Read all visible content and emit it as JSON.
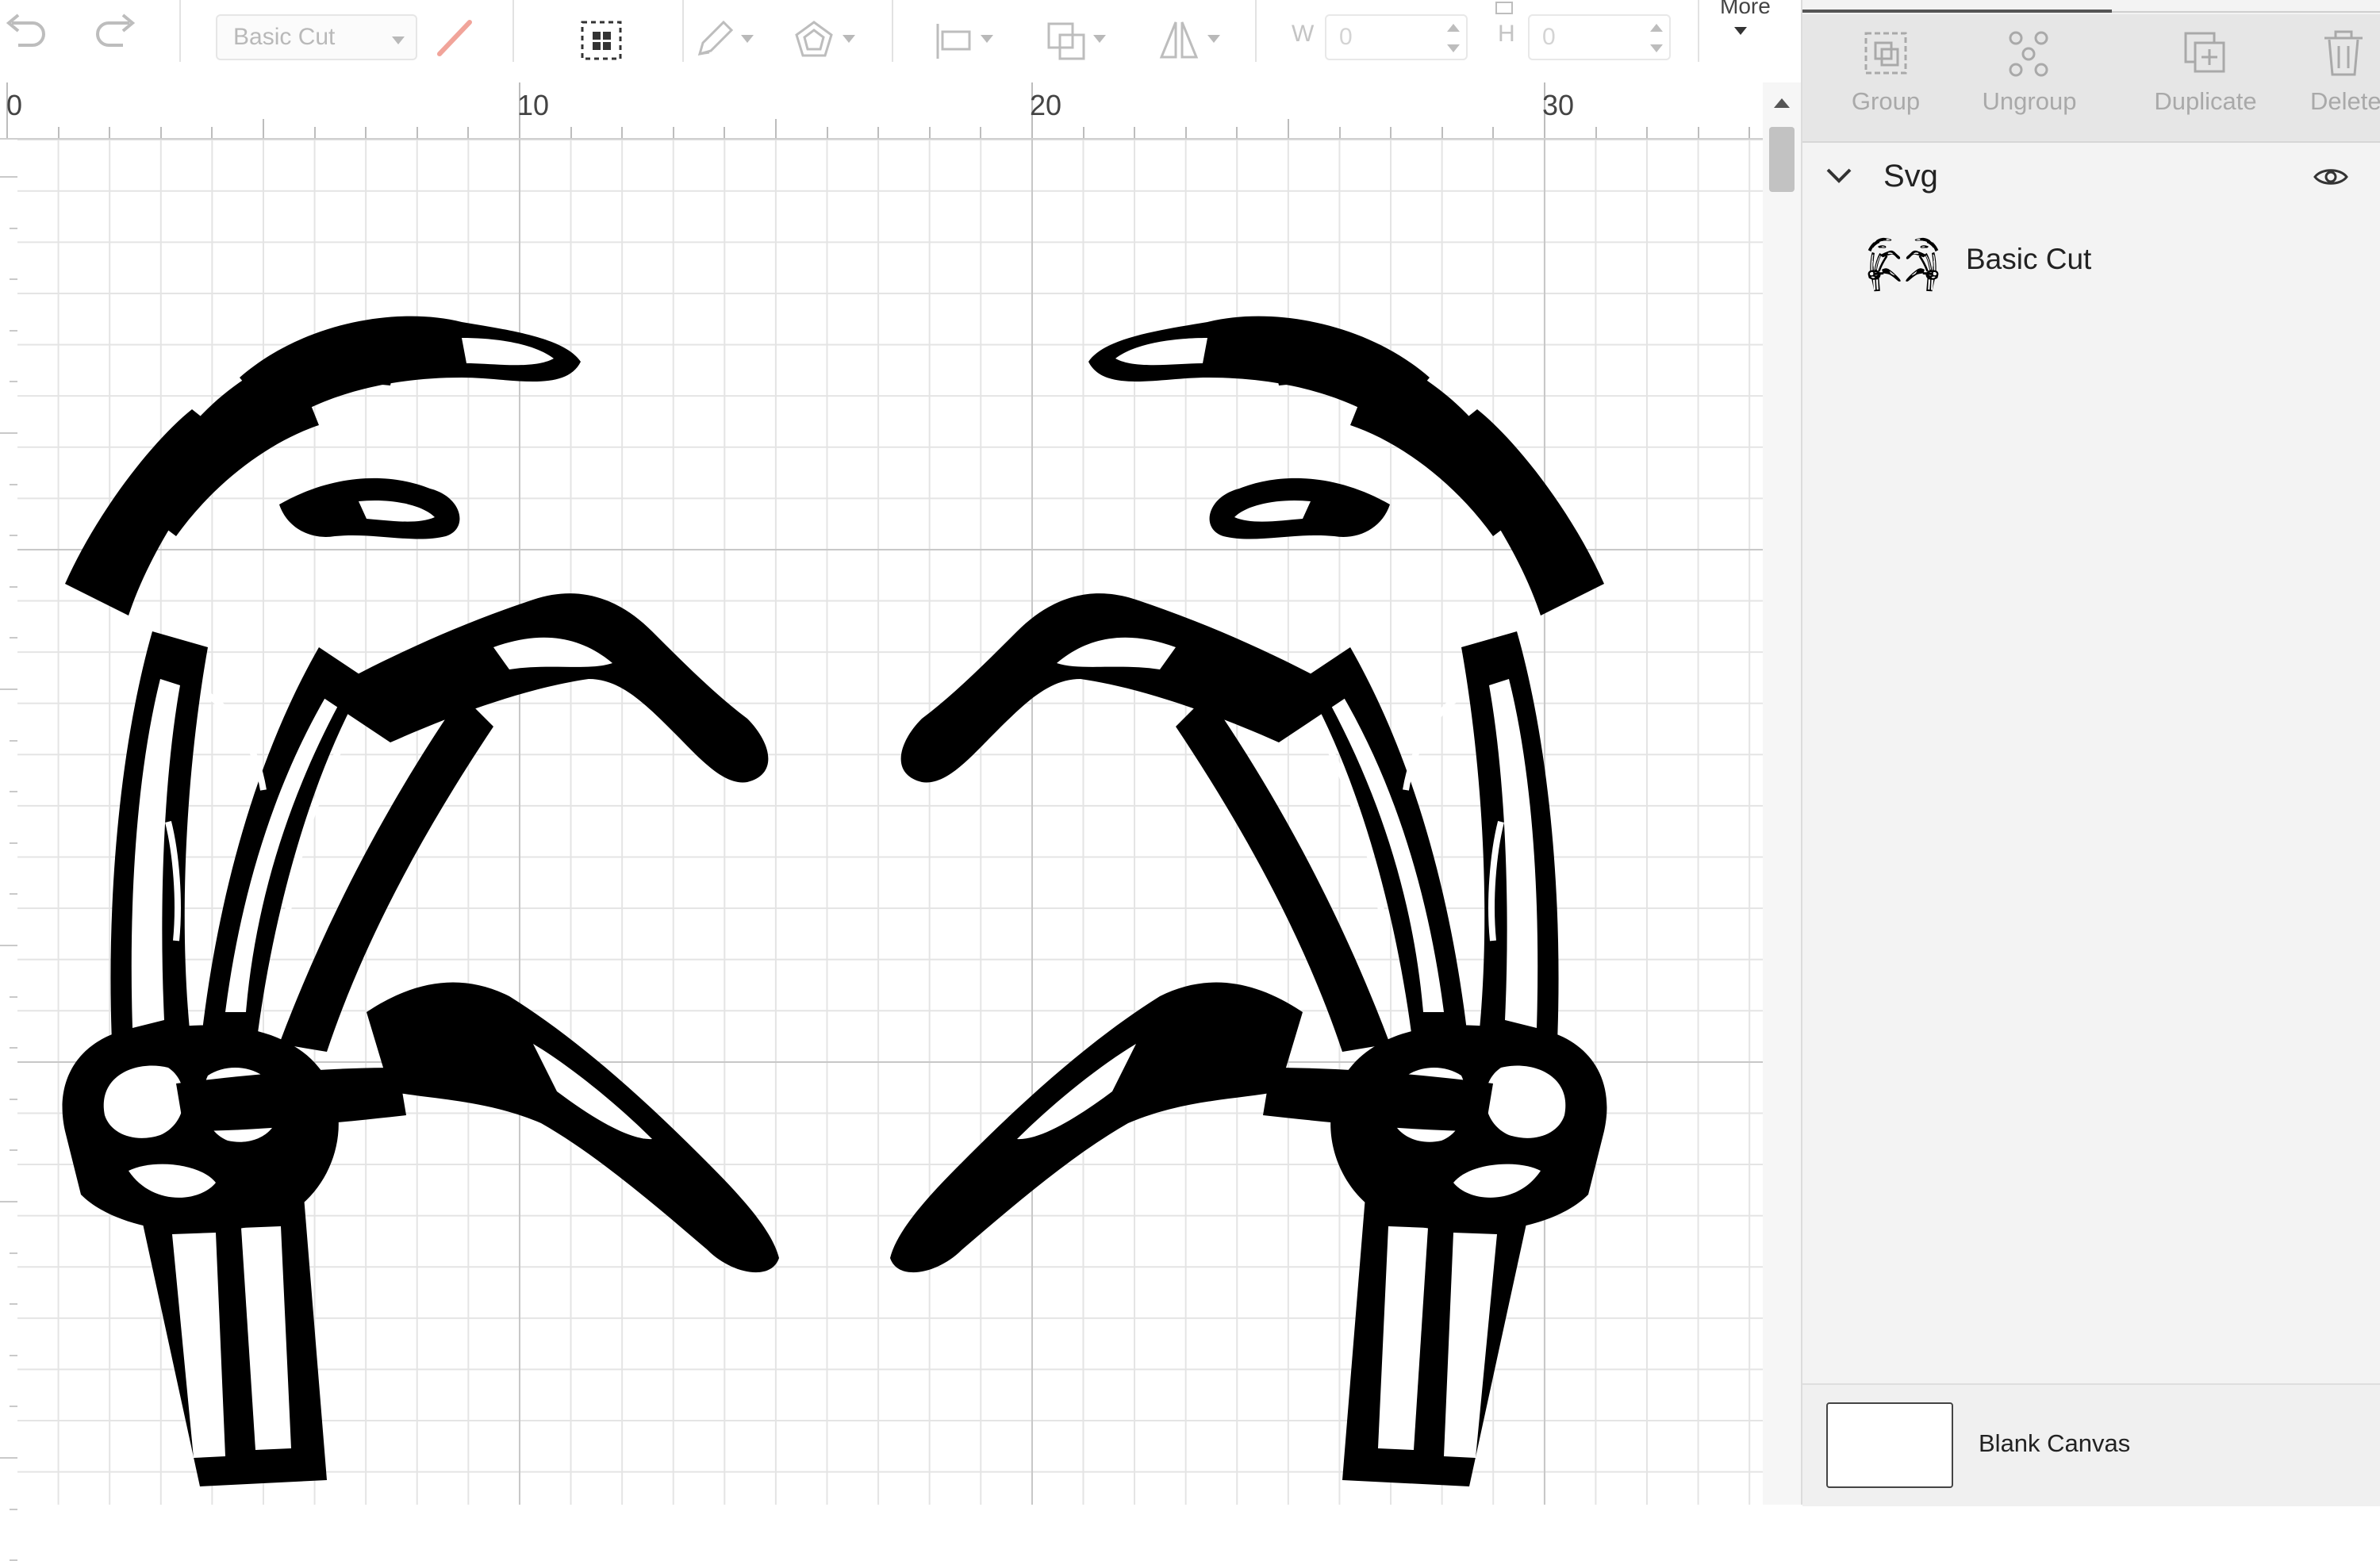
{
  "toolbar": {
    "operation": "Basic Cut",
    "width_label": "W",
    "width_value": "0",
    "height_label": "H",
    "height_value": "0",
    "more_label": "More",
    "pen_color": "#f1a49a"
  },
  "ruler": {
    "labels": [
      "0",
      "10",
      "20",
      "30"
    ]
  },
  "layers_panel": {
    "actions": [
      {
        "label": "Group",
        "icon": "group-icon"
      },
      {
        "label": "Ungroup",
        "icon": "ungroup-icon"
      },
      {
        "label": "Duplicate",
        "icon": "duplicate-icon"
      },
      {
        "label": "Delete",
        "icon": "trash-icon"
      }
    ],
    "group_name": "Svg",
    "layer_name": "Basic Cut",
    "blank_canvas_label": "Blank Canvas"
  },
  "artwork": {
    "description_icon": "skeleton-hands-heart",
    "fill": "#000000"
  }
}
